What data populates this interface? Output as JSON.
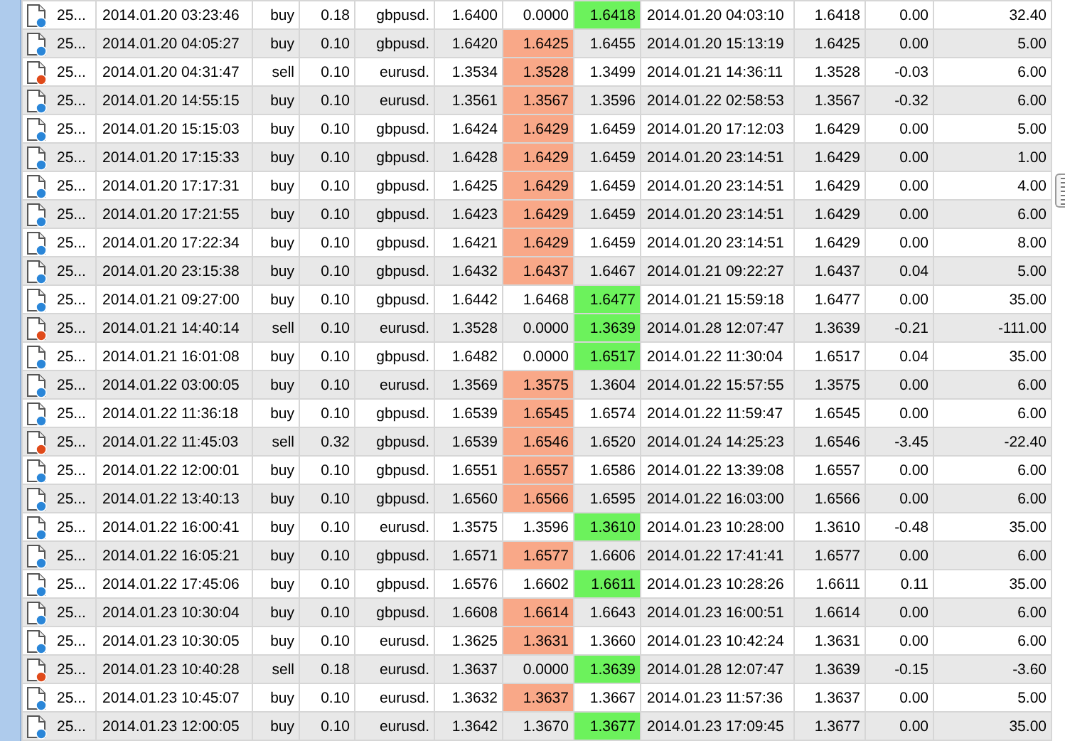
{
  "table": {
    "rows": [
      {
        "kind": "buy",
        "ticket": "25...",
        "open_time": "2014.01.20 03:23:46",
        "type": "buy",
        "size": "0.18",
        "symbol": "gbpusd.",
        "price": "1.6400",
        "sl": "0.0000",
        "tp": "1.6418",
        "close_time": "2014.01.20 04:03:10",
        "close_price": "1.6418",
        "swap": "0.00",
        "profit": "32.40",
        "sl_hit": false,
        "tp_hit": true
      },
      {
        "kind": "buy",
        "ticket": "25...",
        "open_time": "2014.01.20 04:05:27",
        "type": "buy",
        "size": "0.10",
        "symbol": "gbpusd.",
        "price": "1.6420",
        "sl": "1.6425",
        "tp": "1.6455",
        "close_time": "2014.01.20 15:13:19",
        "close_price": "1.6425",
        "swap": "0.00",
        "profit": "5.00",
        "sl_hit": true,
        "tp_hit": false
      },
      {
        "kind": "sell",
        "ticket": "25...",
        "open_time": "2014.01.20 04:31:47",
        "type": "sell",
        "size": "0.10",
        "symbol": "eurusd.",
        "price": "1.3534",
        "sl": "1.3528",
        "tp": "1.3499",
        "close_time": "2014.01.21 14:36:11",
        "close_price": "1.3528",
        "swap": "-0.03",
        "profit": "6.00",
        "sl_hit": true,
        "tp_hit": false
      },
      {
        "kind": "buy",
        "ticket": "25...",
        "open_time": "2014.01.20 14:55:15",
        "type": "buy",
        "size": "0.10",
        "symbol": "eurusd.",
        "price": "1.3561",
        "sl": "1.3567",
        "tp": "1.3596",
        "close_time": "2014.01.22 02:58:53",
        "close_price": "1.3567",
        "swap": "-0.32",
        "profit": "6.00",
        "sl_hit": true,
        "tp_hit": false
      },
      {
        "kind": "buy",
        "ticket": "25...",
        "open_time": "2014.01.20 15:15:03",
        "type": "buy",
        "size": "0.10",
        "symbol": "gbpusd.",
        "price": "1.6424",
        "sl": "1.6429",
        "tp": "1.6459",
        "close_time": "2014.01.20 17:12:03",
        "close_price": "1.6429",
        "swap": "0.00",
        "profit": "5.00",
        "sl_hit": true,
        "tp_hit": false
      },
      {
        "kind": "buy",
        "ticket": "25...",
        "open_time": "2014.01.20 17:15:33",
        "type": "buy",
        "size": "0.10",
        "symbol": "gbpusd.",
        "price": "1.6428",
        "sl": "1.6429",
        "tp": "1.6459",
        "close_time": "2014.01.20 23:14:51",
        "close_price": "1.6429",
        "swap": "0.00",
        "profit": "1.00",
        "sl_hit": true,
        "tp_hit": false
      },
      {
        "kind": "buy",
        "ticket": "25...",
        "open_time": "2014.01.20 17:17:31",
        "type": "buy",
        "size": "0.10",
        "symbol": "gbpusd.",
        "price": "1.6425",
        "sl": "1.6429",
        "tp": "1.6459",
        "close_time": "2014.01.20 23:14:51",
        "close_price": "1.6429",
        "swap": "0.00",
        "profit": "4.00",
        "sl_hit": true,
        "tp_hit": false
      },
      {
        "kind": "buy",
        "ticket": "25...",
        "open_time": "2014.01.20 17:21:55",
        "type": "buy",
        "size": "0.10",
        "symbol": "gbpusd.",
        "price": "1.6423",
        "sl": "1.6429",
        "tp": "1.6459",
        "close_time": "2014.01.20 23:14:51",
        "close_price": "1.6429",
        "swap": "0.00",
        "profit": "6.00",
        "sl_hit": true,
        "tp_hit": false
      },
      {
        "kind": "buy",
        "ticket": "25...",
        "open_time": "2014.01.20 17:22:34",
        "type": "buy",
        "size": "0.10",
        "symbol": "gbpusd.",
        "price": "1.6421",
        "sl": "1.6429",
        "tp": "1.6459",
        "close_time": "2014.01.20 23:14:51",
        "close_price": "1.6429",
        "swap": "0.00",
        "profit": "8.00",
        "sl_hit": true,
        "tp_hit": false
      },
      {
        "kind": "buy",
        "ticket": "25...",
        "open_time": "2014.01.20 23:15:38",
        "type": "buy",
        "size": "0.10",
        "symbol": "gbpusd.",
        "price": "1.6432",
        "sl": "1.6437",
        "tp": "1.6467",
        "close_time": "2014.01.21 09:22:27",
        "close_price": "1.6437",
        "swap": "0.04",
        "profit": "5.00",
        "sl_hit": true,
        "tp_hit": false
      },
      {
        "kind": "buy",
        "ticket": "25...",
        "open_time": "2014.01.21 09:27:00",
        "type": "buy",
        "size": "0.10",
        "symbol": "gbpusd.",
        "price": "1.6442",
        "sl": "1.6468",
        "tp": "1.6477",
        "close_time": "2014.01.21 15:59:18",
        "close_price": "1.6477",
        "swap": "0.00",
        "profit": "35.00",
        "sl_hit": false,
        "tp_hit": true
      },
      {
        "kind": "sell",
        "ticket": "25...",
        "open_time": "2014.01.21 14:40:14",
        "type": "sell",
        "size": "0.10",
        "symbol": "eurusd.",
        "price": "1.3528",
        "sl": "0.0000",
        "tp": "1.3639",
        "close_time": "2014.01.28 12:07:47",
        "close_price": "1.3639",
        "swap": "-0.21",
        "profit": "-111.00",
        "sl_hit": false,
        "tp_hit": true
      },
      {
        "kind": "buy",
        "ticket": "25...",
        "open_time": "2014.01.21 16:01:08",
        "type": "buy",
        "size": "0.10",
        "symbol": "gbpusd.",
        "price": "1.6482",
        "sl": "0.0000",
        "tp": "1.6517",
        "close_time": "2014.01.22 11:30:04",
        "close_price": "1.6517",
        "swap": "0.04",
        "profit": "35.00",
        "sl_hit": false,
        "tp_hit": true
      },
      {
        "kind": "buy",
        "ticket": "25...",
        "open_time": "2014.01.22 03:00:05",
        "type": "buy",
        "size": "0.10",
        "symbol": "eurusd.",
        "price": "1.3569",
        "sl": "1.3575",
        "tp": "1.3604",
        "close_time": "2014.01.22 15:57:55",
        "close_price": "1.3575",
        "swap": "0.00",
        "profit": "6.00",
        "sl_hit": true,
        "tp_hit": false
      },
      {
        "kind": "buy",
        "ticket": "25...",
        "open_time": "2014.01.22 11:36:18",
        "type": "buy",
        "size": "0.10",
        "symbol": "gbpusd.",
        "price": "1.6539",
        "sl": "1.6545",
        "tp": "1.6574",
        "close_time": "2014.01.22 11:59:47",
        "close_price": "1.6545",
        "swap": "0.00",
        "profit": "6.00",
        "sl_hit": true,
        "tp_hit": false
      },
      {
        "kind": "sell",
        "ticket": "25...",
        "open_time": "2014.01.22 11:45:03",
        "type": "sell",
        "size": "0.32",
        "symbol": "gbpusd.",
        "price": "1.6539",
        "sl": "1.6546",
        "tp": "1.6520",
        "close_time": "2014.01.24 14:25:23",
        "close_price": "1.6546",
        "swap": "-3.45",
        "profit": "-22.40",
        "sl_hit": true,
        "tp_hit": false
      },
      {
        "kind": "buy",
        "ticket": "25...",
        "open_time": "2014.01.22 12:00:01",
        "type": "buy",
        "size": "0.10",
        "symbol": "gbpusd.",
        "price": "1.6551",
        "sl": "1.6557",
        "tp": "1.6586",
        "close_time": "2014.01.22 13:39:08",
        "close_price": "1.6557",
        "swap": "0.00",
        "profit": "6.00",
        "sl_hit": true,
        "tp_hit": false
      },
      {
        "kind": "buy",
        "ticket": "25...",
        "open_time": "2014.01.22 13:40:13",
        "type": "buy",
        "size": "0.10",
        "symbol": "gbpusd.",
        "price": "1.6560",
        "sl": "1.6566",
        "tp": "1.6595",
        "close_time": "2014.01.22 16:03:00",
        "close_price": "1.6566",
        "swap": "0.00",
        "profit": "6.00",
        "sl_hit": true,
        "tp_hit": false
      },
      {
        "kind": "buy",
        "ticket": "25...",
        "open_time": "2014.01.22 16:00:41",
        "type": "buy",
        "size": "0.10",
        "symbol": "eurusd.",
        "price": "1.3575",
        "sl": "1.3596",
        "tp": "1.3610",
        "close_time": "2014.01.23 10:28:00",
        "close_price": "1.3610",
        "swap": "-0.48",
        "profit": "35.00",
        "sl_hit": false,
        "tp_hit": true
      },
      {
        "kind": "buy",
        "ticket": "25...",
        "open_time": "2014.01.22 16:05:21",
        "type": "buy",
        "size": "0.10",
        "symbol": "gbpusd.",
        "price": "1.6571",
        "sl": "1.6577",
        "tp": "1.6606",
        "close_time": "2014.01.22 17:41:41",
        "close_price": "1.6577",
        "swap": "0.00",
        "profit": "6.00",
        "sl_hit": true,
        "tp_hit": false
      },
      {
        "kind": "buy",
        "ticket": "25...",
        "open_time": "2014.01.22 17:45:06",
        "type": "buy",
        "size": "0.10",
        "symbol": "gbpusd.",
        "price": "1.6576",
        "sl": "1.6602",
        "tp": "1.6611",
        "close_time": "2014.01.23 10:28:26",
        "close_price": "1.6611",
        "swap": "0.11",
        "profit": "35.00",
        "sl_hit": false,
        "tp_hit": true
      },
      {
        "kind": "buy",
        "ticket": "25...",
        "open_time": "2014.01.23 10:30:04",
        "type": "buy",
        "size": "0.10",
        "symbol": "gbpusd.",
        "price": "1.6608",
        "sl": "1.6614",
        "tp": "1.6643",
        "close_time": "2014.01.23 16:00:51",
        "close_price": "1.6614",
        "swap": "0.00",
        "profit": "6.00",
        "sl_hit": true,
        "tp_hit": false
      },
      {
        "kind": "buy",
        "ticket": "25...",
        "open_time": "2014.01.23 10:30:05",
        "type": "buy",
        "size": "0.10",
        "symbol": "eurusd.",
        "price": "1.3625",
        "sl": "1.3631",
        "tp": "1.3660",
        "close_time": "2014.01.23 10:42:24",
        "close_price": "1.3631",
        "swap": "0.00",
        "profit": "6.00",
        "sl_hit": true,
        "tp_hit": false
      },
      {
        "kind": "sell",
        "ticket": "25...",
        "open_time": "2014.01.23 10:40:28",
        "type": "sell",
        "size": "0.18",
        "symbol": "eurusd.",
        "price": "1.3637",
        "sl": "0.0000",
        "tp": "1.3639",
        "close_time": "2014.01.28 12:07:47",
        "close_price": "1.3639",
        "swap": "-0.15",
        "profit": "-3.60",
        "sl_hit": false,
        "tp_hit": true
      },
      {
        "kind": "buy",
        "ticket": "25...",
        "open_time": "2014.01.23 10:45:07",
        "type": "buy",
        "size": "0.10",
        "symbol": "eurusd.",
        "price": "1.3632",
        "sl": "1.3637",
        "tp": "1.3667",
        "close_time": "2014.01.23 11:57:36",
        "close_price": "1.3637",
        "swap": "0.00",
        "profit": "5.00",
        "sl_hit": true,
        "tp_hit": false
      },
      {
        "kind": "buy",
        "ticket": "25...",
        "open_time": "2014.01.23 12:00:05",
        "type": "buy",
        "size": "0.10",
        "symbol": "eurusd.",
        "price": "1.3642",
        "sl": "1.3670",
        "tp": "1.3677",
        "close_time": "2014.01.23 17:09:45",
        "close_price": "1.3677",
        "swap": "0.00",
        "profit": "35.00",
        "sl_hit": false,
        "tp_hit": true
      }
    ]
  }
}
